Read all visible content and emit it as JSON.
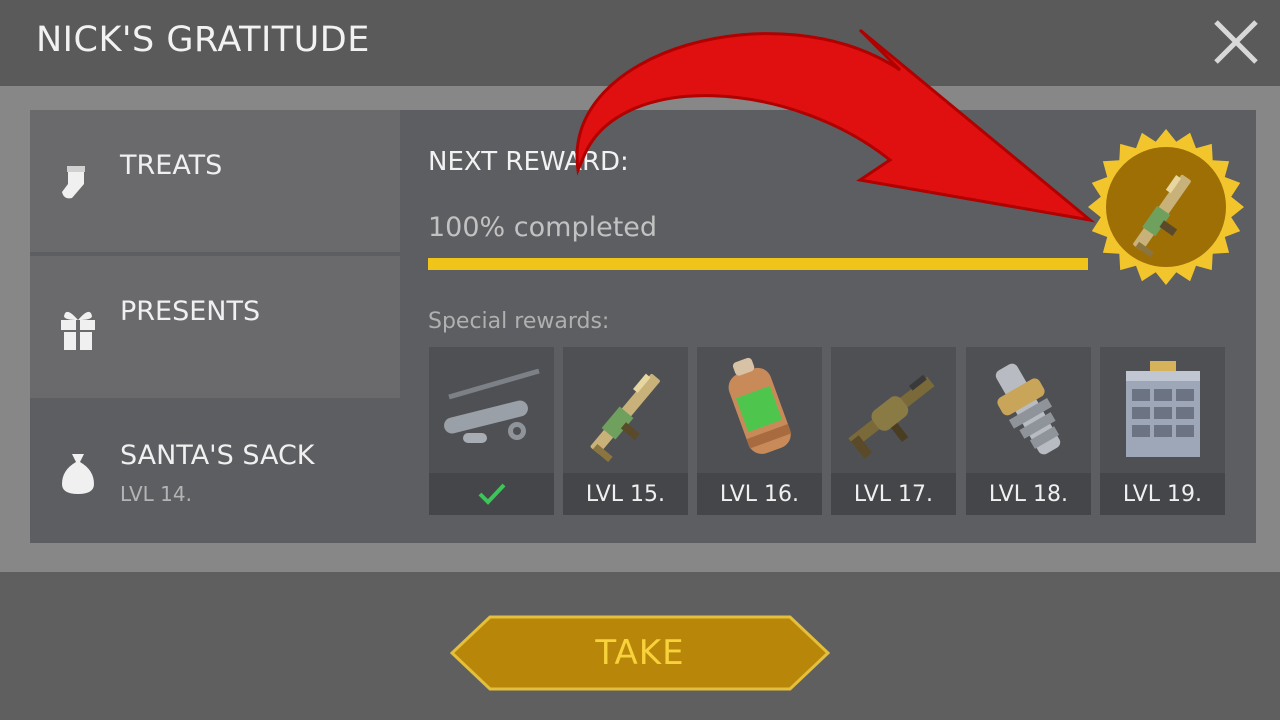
{
  "window": {
    "title": "NICK'S GRATITUDE"
  },
  "tabs": [
    {
      "label": "TREATS",
      "icon": "stocking-icon"
    },
    {
      "label": "PRESENTS",
      "icon": "gift-icon"
    },
    {
      "label": "SANTA'S SACK",
      "sublabel": "LVL 14.",
      "icon": "sack-icon",
      "selected": true
    }
  ],
  "reward": {
    "heading": "NEXT REWARD:",
    "progress_text": "100% completed",
    "progress_fraction": 1.0,
    "badge_icon": "rifle-icon"
  },
  "special": {
    "heading": "Special rewards:",
    "items": [
      {
        "icon": "parts-icon",
        "label": "✓",
        "claimed": true
      },
      {
        "icon": "rifle-icon",
        "label": "LVL 15."
      },
      {
        "icon": "canister-icon",
        "label": "LVL 16."
      },
      {
        "icon": "grenade-launcher-icon",
        "label": "LVL 17."
      },
      {
        "icon": "gear-part-icon",
        "label": "LVL 18."
      },
      {
        "icon": "cabinet-icon",
        "label": "LVL 19."
      }
    ]
  },
  "actions": {
    "take_label": "TAKE"
  },
  "colors": {
    "accent_yellow": "#f0c419",
    "button_gold": "#b8870a",
    "check_green": "#3dc55a",
    "arrow_red": "#e01010"
  }
}
